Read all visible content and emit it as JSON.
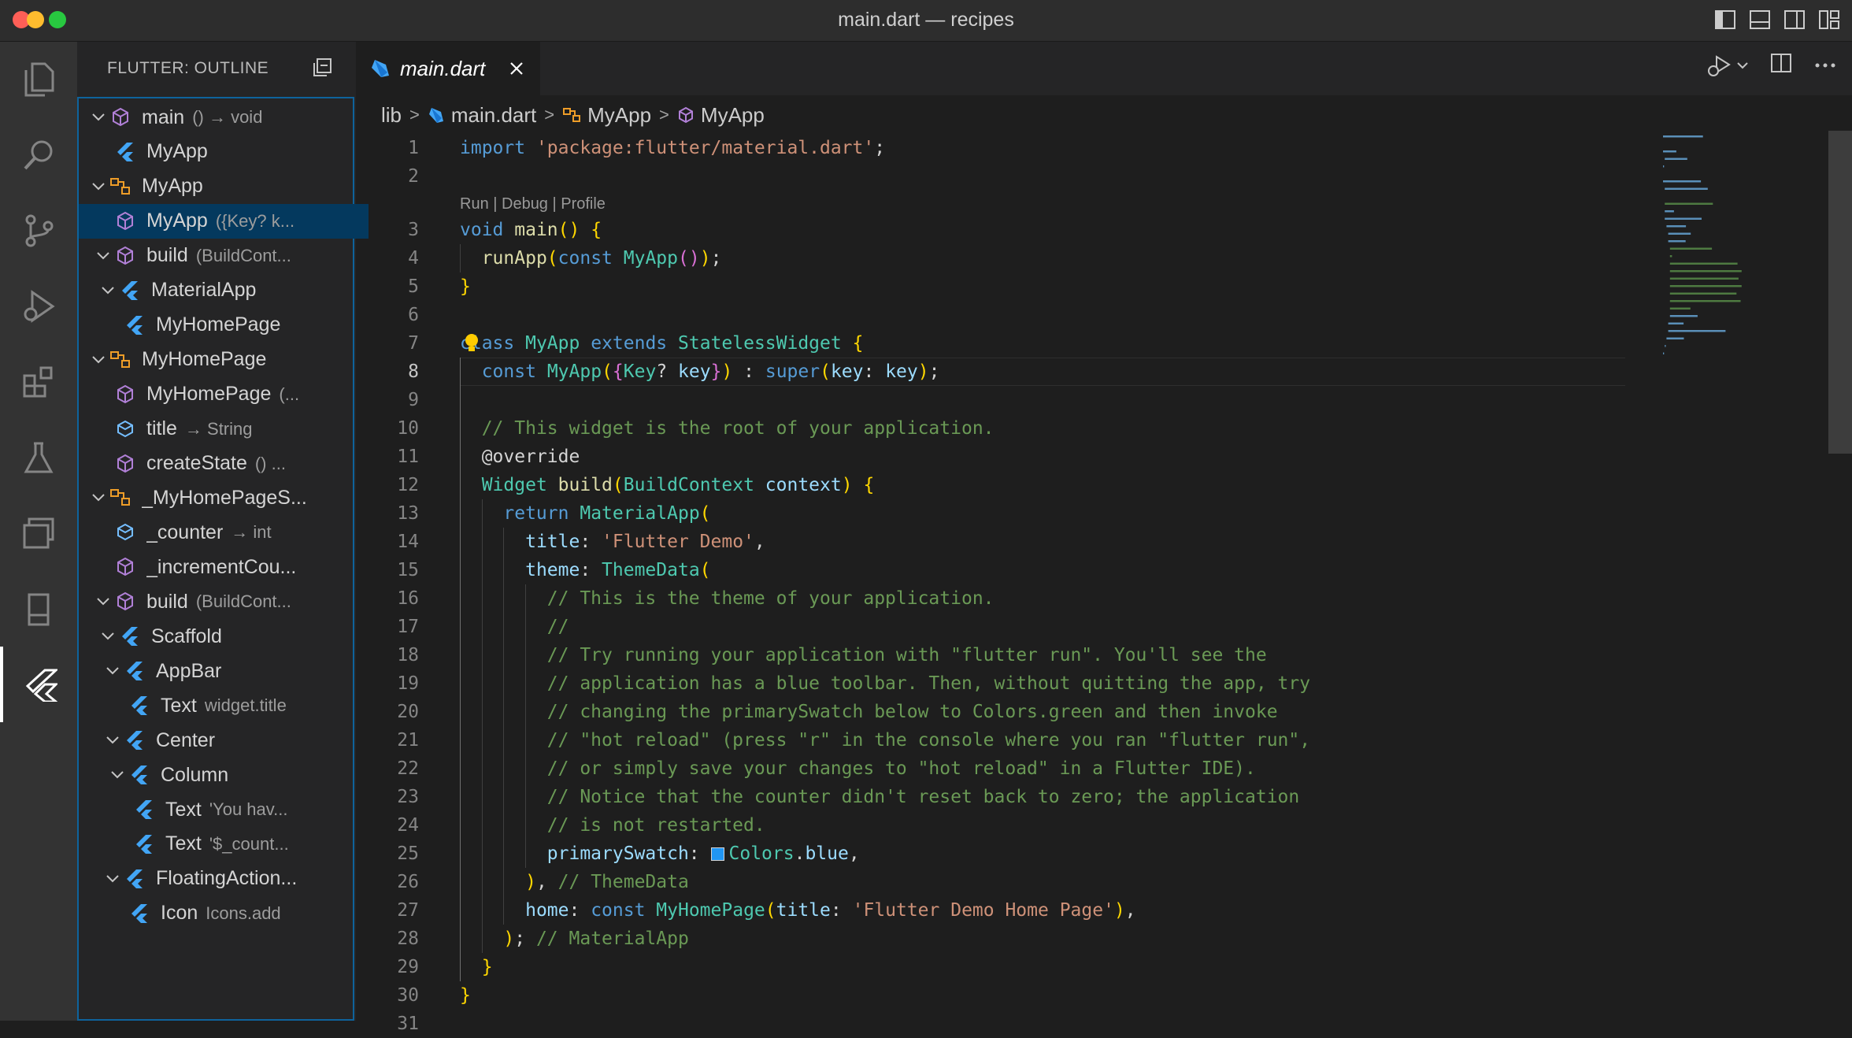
{
  "window": {
    "title": "main.dart — recipes"
  },
  "activity_bar": {
    "items": [
      "explorer-icon",
      "search-icon",
      "source-control-icon",
      "run-debug-icon",
      "extensions-icon",
      "testing-icon",
      "remote-explorer-icon",
      "device-icon",
      "flutter-icon"
    ]
  },
  "sidebar": {
    "title": "FLUTTER: OUTLINE",
    "outline": [
      {
        "label": "main",
        "detail": "() → void",
        "icon": "method-icon"
      },
      {
        "label": "MyApp",
        "detail": "",
        "icon": "flutter-widget-icon"
      },
      {
        "label": "MyApp",
        "detail": "",
        "icon": "class-icon"
      },
      {
        "label": "MyApp",
        "detail": "({Key? k...",
        "icon": "method-icon",
        "selected": true
      },
      {
        "label": "build",
        "detail": "(BuildCont...",
        "icon": "method-icon"
      },
      {
        "label": "MaterialApp",
        "detail": "",
        "icon": "flutter-widget-icon"
      },
      {
        "label": "MyHomePage",
        "detail": "",
        "icon": "flutter-widget-icon"
      },
      {
        "label": "MyHomePage",
        "detail": "",
        "icon": "class-icon"
      },
      {
        "label": "MyHomePage",
        "detail": "(...",
        "icon": "method-icon"
      },
      {
        "label": "title",
        "detail": "→ String",
        "icon": "field-icon"
      },
      {
        "label": "createState",
        "detail": "() ...",
        "icon": "method-icon"
      },
      {
        "label": "_MyHomePageS...",
        "detail": "",
        "icon": "class-icon"
      },
      {
        "label": "_counter",
        "detail": "→ int",
        "icon": "field-icon"
      },
      {
        "label": "_incrementCou...",
        "detail": "",
        "icon": "method-icon"
      },
      {
        "label": "build",
        "detail": "(BuildCont...",
        "icon": "method-icon"
      },
      {
        "label": "Scaffold",
        "detail": "",
        "icon": "flutter-widget-icon"
      },
      {
        "label": "AppBar",
        "detail": "",
        "icon": "flutter-widget-icon"
      },
      {
        "label": "Text",
        "detail": "widget.title",
        "icon": "flutter-widget-icon"
      },
      {
        "label": "Center",
        "detail": "",
        "icon": "flutter-widget-icon"
      },
      {
        "label": "Column",
        "detail": "",
        "icon": "flutter-widget-icon"
      },
      {
        "label": "Text",
        "detail": "'You hav...",
        "icon": "flutter-widget-icon"
      },
      {
        "label": "Text",
        "detail": "'$_count...",
        "icon": "flutter-widget-icon"
      },
      {
        "label": "FloatingAction...",
        "detail": "",
        "icon": "flutter-widget-icon"
      },
      {
        "label": "Icon",
        "detail": "Icons.add",
        "icon": "flutter-widget-icon"
      }
    ]
  },
  "tab": {
    "label": "main.dart"
  },
  "breadcrumb": {
    "parts": [
      "lib",
      "main.dart",
      "MyApp",
      "MyApp"
    ]
  },
  "codelens": "Run | Debug | Profile",
  "editor": {
    "current_line": 8,
    "line_numbers": [
      "1",
      "2",
      "3",
      "4",
      "5",
      "6",
      "7",
      "8",
      "9",
      "10",
      "11",
      "12",
      "13",
      "14",
      "15",
      "16",
      "17",
      "18",
      "19",
      "20",
      "21",
      "22",
      "23",
      "24",
      "25",
      "26",
      "27",
      "28",
      "29",
      "30",
      "31"
    ],
    "lines": [
      "import 'package:flutter/material.dart';",
      "",
      "void main() {",
      "  runApp(const MyApp());",
      "}",
      "",
      "class MyApp extends StatelessWidget {",
      "  const MyApp({Key? key}) : super(key: key);",
      "",
      "  // This widget is the root of your application.",
      "  @override",
      "  Widget build(BuildContext context) {",
      "    return MaterialApp(",
      "      title: 'Flutter Demo',",
      "      theme: ThemeData(",
      "        // This is the theme of your application.",
      "        //",
      "        // Try running your application with \"flutter run\". You'll see the",
      "        // application has a blue toolbar. Then, without quitting the app, try",
      "        // changing the primarySwatch below to Colors.green and then invoke",
      "        // \"hot reload\" (press \"r\" in the console where you ran \"flutter run\",",
      "        // or simply save your changes to \"hot reload\" in a Flutter IDE).",
      "        // Notice that the counter didn't reset back to zero; the application",
      "        // is not restarted.",
      "        primarySwatch: Colors.blue,",
      "      ), // ThemeData",
      "      home: const MyHomePage(title: 'Flutter Demo Home Page'),",
      "    ); // MaterialApp",
      "  }",
      "}",
      ""
    ]
  },
  "colors": {
    "accent": "#0e639c",
    "selection": "#04395e",
    "flutter_blue": "#42a5f5",
    "class_orange": "#ee9d28",
    "method_purple": "#b180d7"
  }
}
